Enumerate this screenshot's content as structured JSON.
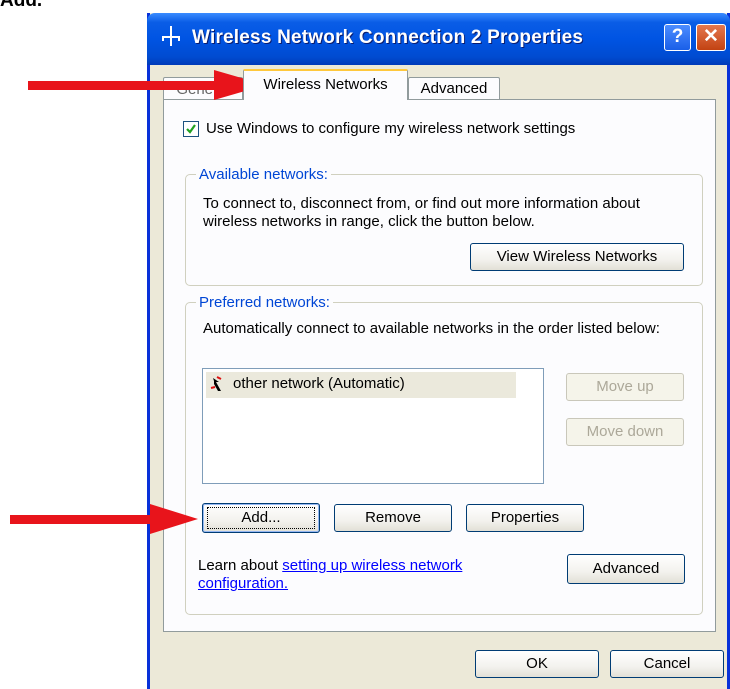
{
  "caption": "Add.",
  "window": {
    "title": "Wireless Network Connection 2 Properties",
    "help_glyph": "?",
    "close_glyph": "✕"
  },
  "tabs": [
    {
      "label": "General"
    },
    {
      "label": "Wireless Networks"
    },
    {
      "label": "Advanced"
    }
  ],
  "use_windows": {
    "checked": true,
    "label": "Use Windows to configure my wireless network settings"
  },
  "available": {
    "title": "Available networks:",
    "description": "To connect to, disconnect from, or find out more information about wireless networks in range, click the button below.",
    "view_button": "View Wireless Networks"
  },
  "preferred": {
    "title": "Preferred networks:",
    "description": "Automatically connect to available networks in the order listed below:",
    "networks": [
      {
        "name": "other network (Automatic)",
        "selected": true
      }
    ],
    "move_up": "Move up",
    "move_down": "Move down",
    "add": "Add...",
    "remove": "Remove",
    "properties": "Properties",
    "learn_prefix": "Learn about ",
    "learn_link": "setting up wireless network configuration.",
    "advanced_button": "Advanced"
  },
  "footer": {
    "ok": "OK",
    "cancel": "Cancel"
  },
  "colors": {
    "arrow": "#e8141b",
    "group_title": "#0046d5",
    "titlebar": "#0054e3"
  }
}
